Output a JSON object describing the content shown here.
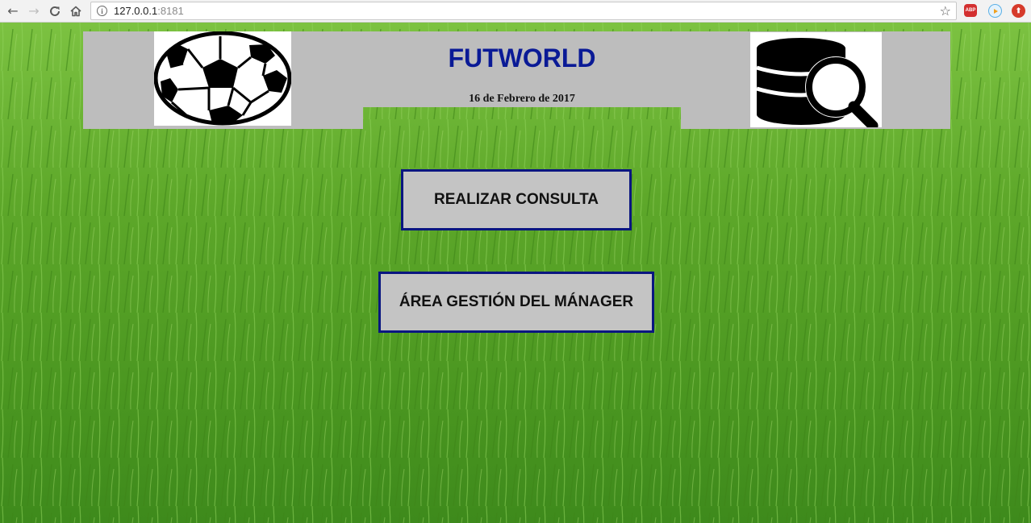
{
  "browser": {
    "url_host": "127.0.0.1",
    "url_port": ":8181",
    "extensions": [
      {
        "name": "adblock-plus-icon",
        "label": "ABP"
      },
      {
        "name": "media-player-icon",
        "label": ""
      },
      {
        "name": "upload-extension-icon",
        "label": "⬆"
      }
    ]
  },
  "header": {
    "title": "FUTWORLD",
    "date": "16 de Febrero de 2017"
  },
  "buttons": {
    "consulta": "REALIZAR CONSULTA",
    "manager": "ÁREA GESTIÓN DEL MÁNAGER"
  },
  "colors": {
    "title": "#0a1a96",
    "button_border": "#0a1680",
    "header_bg": "#bdbdbd",
    "grass": "#5aa624"
  }
}
